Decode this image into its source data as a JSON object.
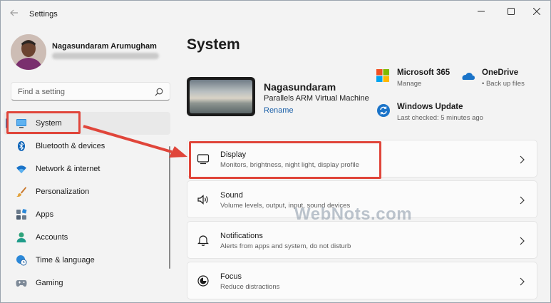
{
  "window": {
    "title": "Settings"
  },
  "user": {
    "name": "Nagasundaram Arumugham"
  },
  "search": {
    "placeholder": "Find a setting"
  },
  "nav": {
    "items": [
      {
        "label": "System",
        "icon": "system-display-icon"
      },
      {
        "label": "Bluetooth & devices",
        "icon": "bluetooth-icon"
      },
      {
        "label": "Network & internet",
        "icon": "wifi-icon"
      },
      {
        "label": "Personalization",
        "icon": "brush-icon"
      },
      {
        "label": "Apps",
        "icon": "apps-icon"
      },
      {
        "label": "Accounts",
        "icon": "accounts-icon"
      },
      {
        "label": "Time & language",
        "icon": "globe-clock-icon"
      },
      {
        "label": "Gaming",
        "icon": "gamepad-icon"
      }
    ],
    "active_index": 0
  },
  "page": {
    "title": "System"
  },
  "device": {
    "name": "Nagasundaram",
    "model": "Parallels ARM Virtual Machine",
    "rename_label": "Rename"
  },
  "quick_links": [
    {
      "title": "Microsoft 365",
      "subtitle": "Manage",
      "icon": "microsoft-logo-icon"
    },
    {
      "title": "OneDrive",
      "subtitle": "Back up files",
      "icon": "onedrive-icon"
    },
    {
      "title": "Windows Update",
      "subtitle": "Last checked: 5 minutes ago",
      "icon": "windows-update-icon"
    }
  ],
  "settings_cards": [
    {
      "title": "Display",
      "subtitle": "Monitors, brightness, night light, display profile",
      "icon": "monitor-icon"
    },
    {
      "title": "Sound",
      "subtitle": "Volume levels, output, input, sound devices",
      "icon": "speaker-icon"
    },
    {
      "title": "Notifications",
      "subtitle": "Alerts from apps and system, do not disturb",
      "icon": "bell-icon"
    },
    {
      "title": "Focus",
      "subtitle": "Reduce distractions",
      "icon": "focus-icon"
    }
  ],
  "watermark": "WebNots.com",
  "colors": {
    "accent": "#0067c0",
    "annotation": "#e0453a",
    "link": "#1a5fa8"
  }
}
